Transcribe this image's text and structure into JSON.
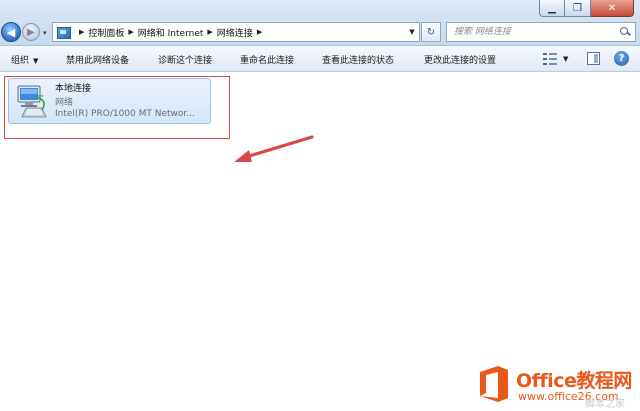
{
  "window": {
    "controls": {
      "minimize": "▁",
      "maximize": "❐",
      "close": "✕"
    }
  },
  "navigation": {
    "back_glyph": "◀",
    "forward_glyph": "▶",
    "dropdown_glyph": "▾"
  },
  "address_bar": {
    "breadcrumb": [
      "控制面板",
      "网络和 Internet",
      "网络连接"
    ],
    "separator_glyph": "▶",
    "dropdown_glyph": "▼",
    "refresh_glyph": "↻"
  },
  "search": {
    "placeholder": "搜索 网络连接"
  },
  "command_bar": {
    "organize": "组织",
    "organize_dropdown": "▼",
    "commands": [
      "禁用此网络设备",
      "诊断这个连接",
      "重命名此连接",
      "查看此连接的状态",
      "更改此连接的设置"
    ],
    "view_dropdown": "▼",
    "help_glyph": "?"
  },
  "connection": {
    "name": "本地连接",
    "network": "网络",
    "device": "Intel(R) PRO/1000 MT Networ..."
  },
  "annotation": {
    "box_color": "#d84a4a",
    "arrow_color": "#d84a4a"
  },
  "watermark": {
    "title": "Office教程网",
    "url": "www.office26.com",
    "faint": "脚本之家"
  }
}
